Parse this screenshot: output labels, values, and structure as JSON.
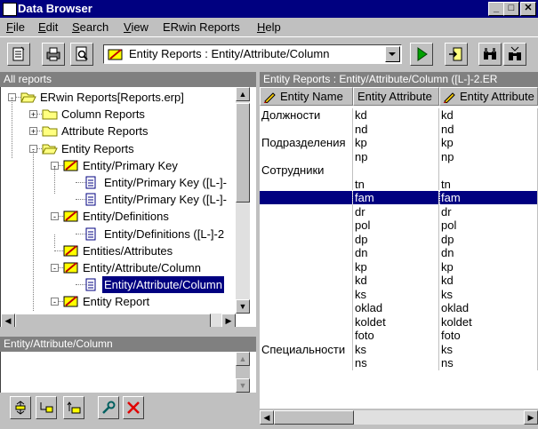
{
  "window": {
    "title": "Data Browser"
  },
  "menu": [
    {
      "key": "F",
      "rest": "ile"
    },
    {
      "key": "E",
      "rest": "dit"
    },
    {
      "key": "S",
      "rest": "earch"
    },
    {
      "key": "V",
      "rest": "iew"
    },
    {
      "key": "",
      "rest": "ERwin Reports"
    },
    {
      "key": "H",
      "rest": "elp"
    }
  ],
  "toolbar": {
    "report_selector": "Entity Reports : Entity/Attribute/Column"
  },
  "left_panel": {
    "header": "All reports",
    "tree": [
      {
        "label": "ERwin Reports[Reports.erp]",
        "level": 0,
        "icon": "folder-open-icon",
        "expander": "-"
      },
      {
        "label": "Column Reports",
        "level": 1,
        "icon": "folder-icon",
        "expander": "+"
      },
      {
        "label": "Attribute Reports",
        "level": 1,
        "icon": "folder-icon",
        "expander": "+"
      },
      {
        "label": "Entity Reports",
        "level": 1,
        "icon": "folder-open-icon",
        "expander": "-"
      },
      {
        "label": "Entity/Primary Key",
        "level": 2,
        "icon": "report-icon",
        "expander": "-"
      },
      {
        "label": "Entity/Primary Key   ([L-]-",
        "level": 3,
        "icon": "document-icon",
        "expander": ""
      },
      {
        "label": "Entity/Primary Key   ([L-]-",
        "level": 3,
        "icon": "document-icon",
        "expander": ""
      },
      {
        "label": "Entity/Definitions",
        "level": 2,
        "icon": "report-icon",
        "expander": "-"
      },
      {
        "label": "Entity/Definitions   ([L-]-2",
        "level": 3,
        "icon": "document-icon",
        "expander": ""
      },
      {
        "label": "Entities/Attributes",
        "level": 2,
        "icon": "report-icon",
        "expander": ""
      },
      {
        "label": "Entity/Attribute/Column",
        "level": 2,
        "icon": "report-icon",
        "expander": "-"
      },
      {
        "label": "Entity/Attribute/Column",
        "level": 3,
        "icon": "document-icon",
        "expander": "",
        "selected": true
      },
      {
        "label": "Entity Report",
        "level": 2,
        "icon": "report-icon",
        "expander": "-"
      }
    ]
  },
  "bottom_panel": {
    "header": "Entity/Attribute/Column"
  },
  "right_panel": {
    "header": "Entity Reports : Entity/Attribute/Column   ([L-]-2.ER",
    "columns": [
      "Entity Name",
      "Entity Attribute",
      "Entity Attribute"
    ],
    "rows": [
      [
        "Должности",
        "kd",
        "kd"
      ],
      [
        "",
        "nd",
        "nd"
      ],
      [
        "Подразделения",
        "kp",
        "kp"
      ],
      [
        "",
        "np",
        "np"
      ],
      [
        "Сотрудники",
        "",
        ""
      ],
      [
        "",
        "tn",
        "tn"
      ],
      [
        "",
        "fam",
        "fam"
      ],
      [
        "",
        "dr",
        "dr"
      ],
      [
        "",
        "pol",
        "pol"
      ],
      [
        "",
        "dp",
        "dp"
      ],
      [
        "",
        "dn",
        "dn"
      ],
      [
        "",
        "kp",
        "kp"
      ],
      [
        "",
        "kd",
        "kd"
      ],
      [
        "",
        "ks",
        "ks"
      ],
      [
        "",
        "oklad",
        "oklad"
      ],
      [
        "",
        "koldet",
        "koldet"
      ],
      [
        "",
        "foto",
        "foto"
      ],
      [
        "Специальности",
        "ks",
        "ks"
      ],
      [
        "",
        "ns",
        "ns"
      ]
    ],
    "selected_row": 6
  },
  "colors": {
    "title_bar": "#000080",
    "selection": "#000080",
    "face": "#c0c0c0"
  }
}
